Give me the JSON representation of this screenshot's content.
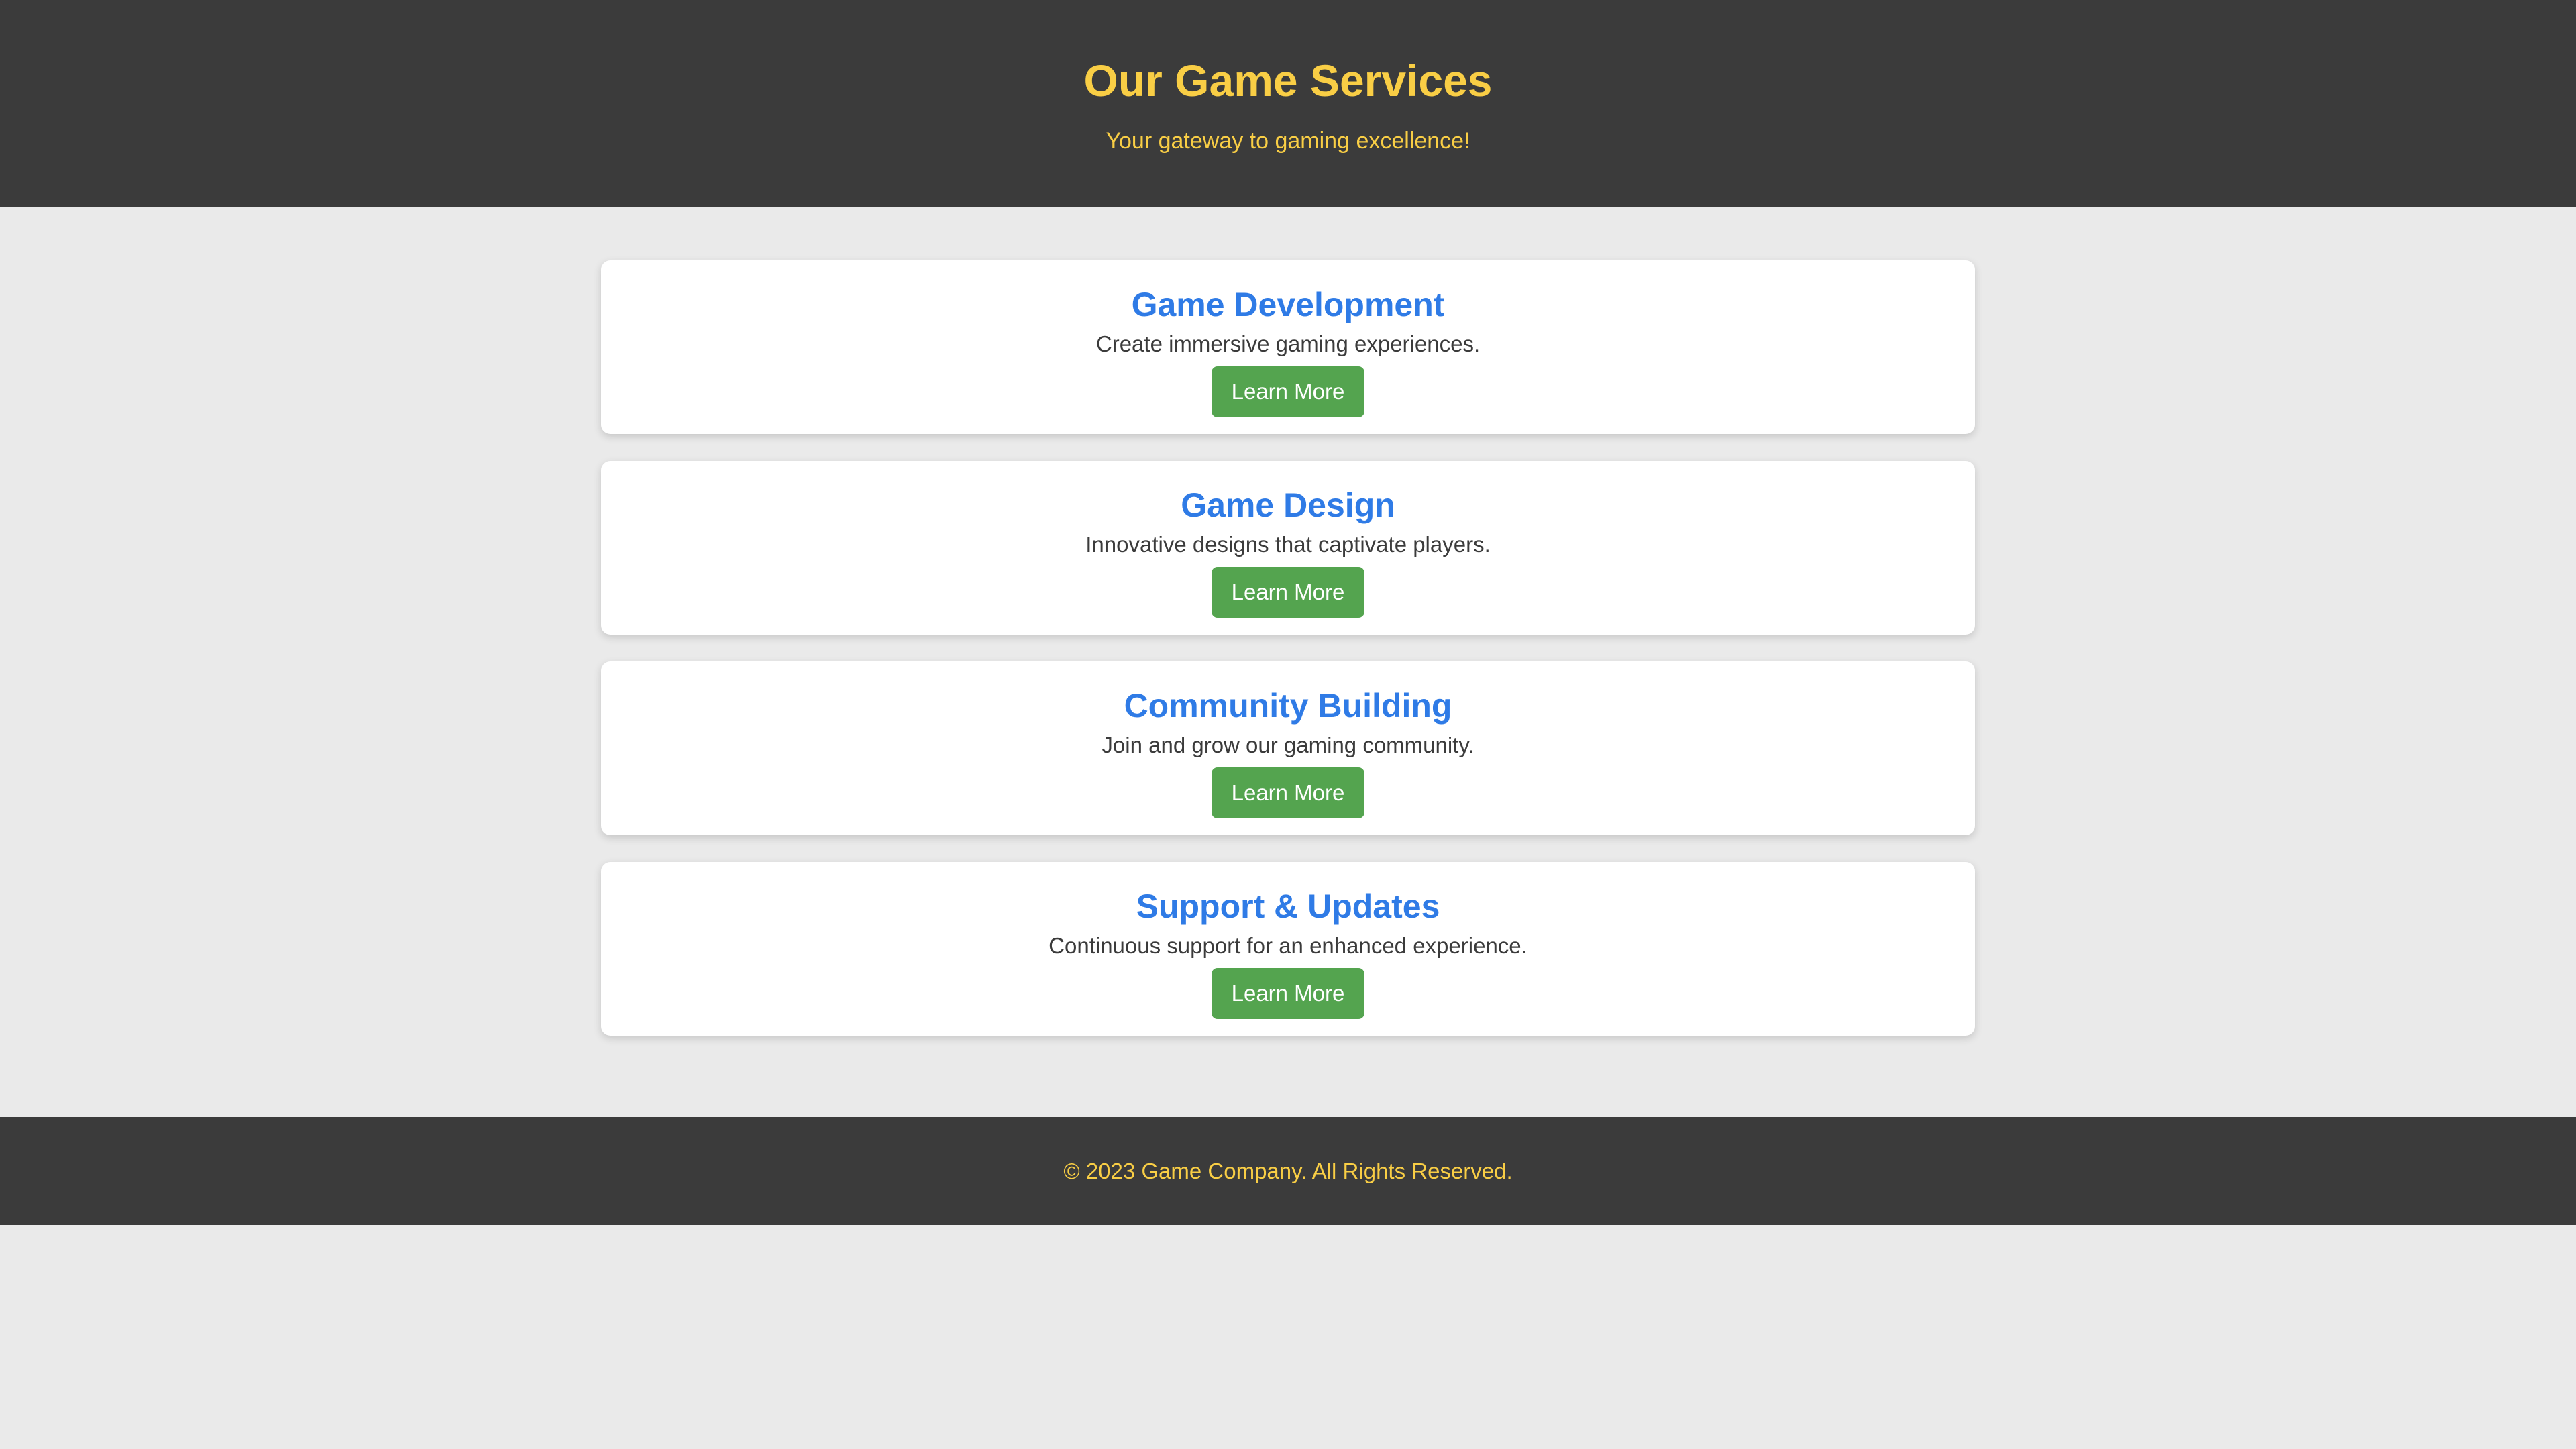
{
  "header": {
    "title": "Our Game Services",
    "tagline": "Your gateway to gaming excellence!"
  },
  "services": [
    {
      "title": "Game Development",
      "description": "Create immersive gaming experiences.",
      "button_label": "Learn More"
    },
    {
      "title": "Game Design",
      "description": "Innovative designs that captivate players.",
      "button_label": "Learn More"
    },
    {
      "title": "Community Building",
      "description": "Join and grow our gaming community.",
      "button_label": "Learn More"
    },
    {
      "title": "Support & Updates",
      "description": "Continuous support for an enhanced experience.",
      "button_label": "Learn More"
    }
  ],
  "footer": {
    "text": "© 2023 Game Company. All Rights Reserved."
  },
  "colors": {
    "header_bg": "#3b3b3b",
    "accent_yellow": "#f9ce45",
    "service_title_blue": "#2f7be6",
    "button_green": "#54a44f",
    "page_bg": "#eaeaea"
  }
}
